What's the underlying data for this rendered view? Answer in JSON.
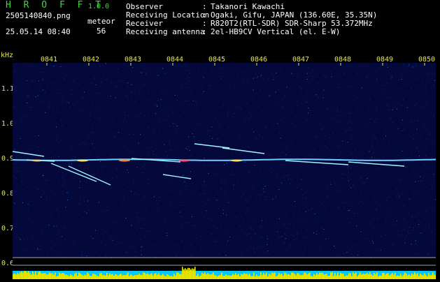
{
  "header": {
    "app_title": "H R O F F T",
    "app_version": "1.0.0",
    "filename": "2505140840.png",
    "meteor_label": "meteor",
    "meteor_count": "56",
    "datetime": "25.05.14 08:40"
  },
  "info": [
    {
      "key": "Observer",
      "value": "Takanori Kawachi"
    },
    {
      "key": "Receiving Location",
      "value": "Ogaki, Gifu, JAPAN (136.60E, 35.35N)"
    },
    {
      "key": "Receiver",
      "value": "R820T2(RTL-SDR) SDR-Sharp 53.372MHz"
    },
    {
      "key": "Receiving antenna",
      "value": "2el-HB9CV Vertical (el. E-W)"
    }
  ],
  "spectrogram": {
    "unit_label": "kHz",
    "y_ticks": [
      "1.1",
      "1.0",
      "0.9",
      "0.8",
      "0.7",
      "0.6"
    ],
    "x_ticks": [
      "0841",
      "0842",
      "0843",
      "0844",
      "0845",
      "0846",
      "0847",
      "0848",
      "0849",
      "0850"
    ],
    "colors": {
      "background": "#05083a",
      "carrier": "#6fd0ff",
      "meteor": "#9ff4ff",
      "axis_text": "#e6e64a",
      "noise_band": "#00c8ff",
      "noise_peak": "#f0f000"
    }
  }
}
